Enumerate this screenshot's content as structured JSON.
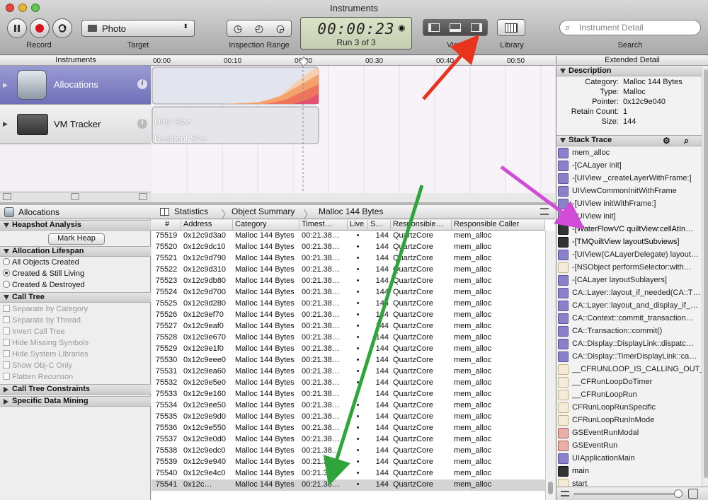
{
  "window": {
    "title": "Instruments"
  },
  "toolbar": {
    "record_label": "Record",
    "target_value": "Photo",
    "target_label": "Target",
    "inspection_label": "Inspection Range",
    "timer": "00:00:23",
    "run": "Run 3 of 3",
    "view_label": "View",
    "library_label": "Library",
    "search_placeholder": "Instrument Detail",
    "search_label": "Search"
  },
  "instruments": {
    "header": "Instruments",
    "items": [
      {
        "name": "Allocations"
      },
      {
        "name": "VM Tracker"
      }
    ],
    "vm_labels": [
      "Dirty Size",
      "Resident Size"
    ]
  },
  "timeline": {
    "ticks": [
      "00:00",
      "00:10",
      "00:20",
      "00:30",
      "00:40",
      "00:50"
    ]
  },
  "left": {
    "title": "Allocations",
    "heapshot": "Heapshot Analysis",
    "mark_heap": "Mark Heap",
    "lifespan": "Allocation Lifespan",
    "lifespan_opts": [
      "All Objects Created",
      "Created & Still Living",
      "Created & Destroyed"
    ],
    "calltree": "Call Tree",
    "calltree_opts": [
      "Separate by Category",
      "Separate by Thread",
      "Invert Call Tree",
      "Hide Missing Symbols",
      "Hide System Libraries",
      "Show Obj-C Only",
      "Flatten Recursion"
    ],
    "constraints": "Call Tree Constraints",
    "mining": "Specific Data Mining"
  },
  "crumbs": [
    "Statistics",
    "Object Summary",
    "Malloc 144 Bytes"
  ],
  "table": {
    "columns": [
      "#",
      "Address",
      "Category",
      "Timest…",
      "Live",
      "S…",
      "Responsible…",
      "Responsible Caller"
    ],
    "rows": [
      [
        "75519",
        "0x12c9d3a0",
        "Malloc 144 Bytes",
        "00:21.38…",
        "•",
        "144",
        "QuartzCore",
        "mem_alloc"
      ],
      [
        "75520",
        "0x12c9dc10",
        "Malloc 144 Bytes",
        "00:21.38…",
        "•",
        "144",
        "QuartzCore",
        "mem_alloc"
      ],
      [
        "75521",
        "0x12c9d790",
        "Malloc 144 Bytes",
        "00:21.38…",
        "•",
        "144",
        "QuartzCore",
        "mem_alloc"
      ],
      [
        "75522",
        "0x12c9d310",
        "Malloc 144 Bytes",
        "00:21.38…",
        "•",
        "144",
        "QuartzCore",
        "mem_alloc"
      ],
      [
        "75523",
        "0x12c9db80",
        "Malloc 144 Bytes",
        "00:21.38…",
        "•",
        "144",
        "QuartzCore",
        "mem_alloc"
      ],
      [
        "75524",
        "0x12c9d700",
        "Malloc 144 Bytes",
        "00:21.38…",
        "•",
        "144",
        "QuartzCore",
        "mem_alloc"
      ],
      [
        "75525",
        "0x12c9d280",
        "Malloc 144 Bytes",
        "00:21.38…",
        "•",
        "144",
        "QuartzCore",
        "mem_alloc"
      ],
      [
        "75526",
        "0x12c9ef70",
        "Malloc 144 Bytes",
        "00:21.38…",
        "•",
        "144",
        "QuartzCore",
        "mem_alloc"
      ],
      [
        "75527",
        "0x12c9eaf0",
        "Malloc 144 Bytes",
        "00:21.38…",
        "•",
        "144",
        "QuartzCore",
        "mem_alloc"
      ],
      [
        "75528",
        "0x12c9e670",
        "Malloc 144 Bytes",
        "00:21.38…",
        "•",
        "144",
        "QuartzCore",
        "mem_alloc"
      ],
      [
        "75529",
        "0x12c9e1f0",
        "Malloc 144 Bytes",
        "00:21.38…",
        "•",
        "144",
        "QuartzCore",
        "mem_alloc"
      ],
      [
        "75530",
        "0x12c9eee0",
        "Malloc 144 Bytes",
        "00:21.38…",
        "•",
        "144",
        "QuartzCore",
        "mem_alloc"
      ],
      [
        "75531",
        "0x12c9ea60",
        "Malloc 144 Bytes",
        "00:21.38…",
        "•",
        "144",
        "QuartzCore",
        "mem_alloc"
      ],
      [
        "75532",
        "0x12c9e5e0",
        "Malloc 144 Bytes",
        "00:21.38…",
        "•",
        "144",
        "QuartzCore",
        "mem_alloc"
      ],
      [
        "75533",
        "0x12c9e160",
        "Malloc 144 Bytes",
        "00:21.38…",
        "•",
        "144",
        "QuartzCore",
        "mem_alloc"
      ],
      [
        "75534",
        "0x12c9ee50",
        "Malloc 144 Bytes",
        "00:21.38…",
        "•",
        "144",
        "QuartzCore",
        "mem_alloc"
      ],
      [
        "75535",
        "0x12c9e9d0",
        "Malloc 144 Bytes",
        "00:21.38…",
        "•",
        "144",
        "QuartzCore",
        "mem_alloc"
      ],
      [
        "75536",
        "0x12c9e550",
        "Malloc 144 Bytes",
        "00:21.38…",
        "•",
        "144",
        "QuartzCore",
        "mem_alloc"
      ],
      [
        "75537",
        "0x12c9e0d0",
        "Malloc 144 Bytes",
        "00:21.38…",
        "•",
        "144",
        "QuartzCore",
        "mem_alloc"
      ],
      [
        "75538",
        "0x12c9edc0",
        "Malloc 144 Bytes",
        "00:21.38…",
        "•",
        "144",
        "QuartzCore",
        "mem_alloc"
      ],
      [
        "75539",
        "0x12c9e940",
        "Malloc 144 Bytes",
        "00:21.38…",
        "•",
        "144",
        "QuartzCore",
        "mem_alloc"
      ],
      [
        "75540",
        "0x12c9e4c0",
        "Malloc 144 Bytes",
        "00:21.38…",
        "•",
        "144",
        "QuartzCore",
        "mem_alloc"
      ],
      [
        "75541",
        "0x12c…",
        "Malloc 144 Bytes",
        "00:21.38…",
        "•",
        "144",
        "QuartzCore",
        "mem_alloc"
      ]
    ]
  },
  "extended": {
    "header": "Extended Detail",
    "desc_title": "Description",
    "desc": [
      {
        "k": "Category:",
        "v": "Malloc 144 Bytes"
      },
      {
        "k": "Type:",
        "v": "Malloc"
      },
      {
        "k": "Pointer:",
        "v": "0x12c9e040"
      },
      {
        "k": "Retain Count:",
        "v": "1"
      },
      {
        "k": "Size:",
        "v": "144"
      }
    ],
    "stack_title": "Stack Trace",
    "stack": [
      {
        "t": "mem_alloc",
        "icon": "p"
      },
      {
        "t": "-[CALayer init]",
        "icon": "p"
      },
      {
        "t": "-[UIView _createLayerWithFrame:]",
        "icon": "p"
      },
      {
        "t": "UIViewCommonInitWithFrame",
        "icon": "p"
      },
      {
        "t": "-[UIView initWithFrame:]",
        "icon": "p"
      },
      {
        "t": "-[UIView init]",
        "icon": "p"
      },
      {
        "t": "-[WaterFlowVC quiltView:cellAtIn…",
        "icon": "k"
      },
      {
        "t": "-[TMQuiltView layoutSubviews]",
        "icon": "k"
      },
      {
        "t": "-[UIView(CALayerDelegate) layout…",
        "icon": "p"
      },
      {
        "t": "-[NSObject performSelector:with…",
        "icon": "f"
      },
      {
        "t": "-[CALayer layoutSublayers]",
        "icon": "p"
      },
      {
        "t": "CA::Layer::layout_if_needed(CA::T…",
        "icon": "p"
      },
      {
        "t": "CA::Layer::layout_and_display_if_…",
        "icon": "p"
      },
      {
        "t": "CA::Context::commit_transaction…",
        "icon": "p"
      },
      {
        "t": "CA::Transaction::commit()",
        "icon": "p"
      },
      {
        "t": "CA::Display::DisplayLink::dispatc…",
        "icon": "p"
      },
      {
        "t": "CA::Display::TimerDisplayLink::ca…",
        "icon": "p"
      },
      {
        "t": "__CFRUNLOOP_IS_CALLING_OUT_…",
        "icon": "f"
      },
      {
        "t": "__CFRunLoopDoTimer",
        "icon": "f"
      },
      {
        "t": "__CFRunLoopRun",
        "icon": "f"
      },
      {
        "t": "CFRunLoopRunSpecific",
        "icon": "f"
      },
      {
        "t": "CFRunLoopRunInMode",
        "icon": "f"
      },
      {
        "t": "GSEventRunModal",
        "icon": "r"
      },
      {
        "t": "GSEventRun",
        "icon": "r"
      },
      {
        "t": "UIApplicationMain",
        "icon": "p"
      },
      {
        "t": "main",
        "icon": "k"
      },
      {
        "t": "start",
        "icon": "f"
      }
    ]
  },
  "colors": {
    "accent": "#6f6fb8",
    "arrow_red": "#e8331f",
    "arrow_green": "#2ea43a",
    "arrow_magenta": "#d04bd6"
  }
}
